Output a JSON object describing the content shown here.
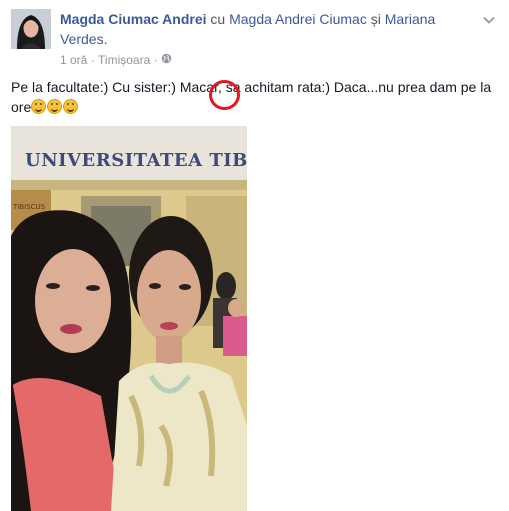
{
  "post": {
    "author": "Magda Ciumac Andrei",
    "with_word": "cu",
    "tagged_1": "Magda Andrei Ciumac",
    "and_word": "și",
    "tagged_2": "Mariana Verdes",
    "end_punct": ".",
    "time": "1 oră",
    "separator": "·",
    "location": "Timișoara",
    "privacy_icon": "globe-icon",
    "menu_icon": "chevron-down-icon",
    "text": "Pe la facultate:) Cu sister:) Macar, sa achitam rata:) Daca...nu prea dam pe la ore",
    "emoji_count": 3,
    "photo_sign_text": "UNIVERSITATEA TIBISCUS",
    "photo_small_sign": "TIBISCUS"
  },
  "colors": {
    "link": "#3b5998",
    "meta": "#90949c",
    "annotation": "#e5171e"
  }
}
